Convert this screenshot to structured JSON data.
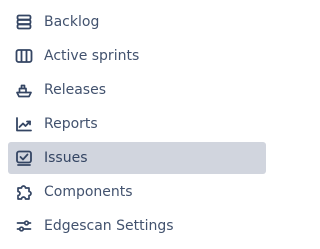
{
  "sidebar": {
    "items": [
      {
        "label": "Backlog",
        "icon": "backlog-icon",
        "active": false
      },
      {
        "label": "Active sprints",
        "icon": "board-columns-icon",
        "active": false
      },
      {
        "label": "Releases",
        "icon": "ship-icon",
        "active": false
      },
      {
        "label": "Reports",
        "icon": "trend-chart-icon",
        "active": false
      },
      {
        "label": "Issues",
        "icon": "issues-check-icon",
        "active": true
      },
      {
        "label": "Components",
        "icon": "puzzle-icon",
        "active": false
      },
      {
        "label": "Edgescan Settings",
        "icon": "sliders-icon",
        "active": false
      }
    ]
  },
  "colors": {
    "text": "#42526e",
    "icon": "#344563",
    "active_background": "#d1d5de"
  }
}
